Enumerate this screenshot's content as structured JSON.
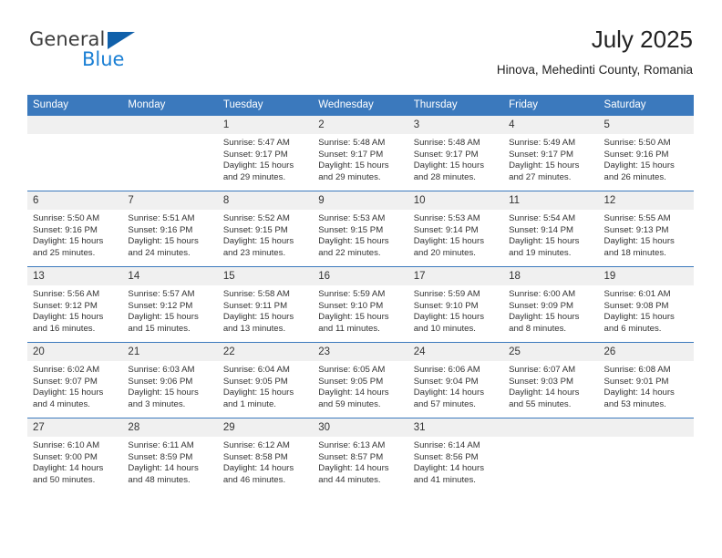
{
  "brand": {
    "name_part1": "General",
    "name_part2": "Blue",
    "triangle_color": "#1060aa",
    "blue_color": "#1a7fd4"
  },
  "header": {
    "title": "July 2025",
    "subtitle": "Hinova, Mehedinti County, Romania"
  },
  "calendar": {
    "accent_color": "#3b79bd",
    "daynum_band_color": "#f0f0f0",
    "weekday_headers": [
      "Sunday",
      "Monday",
      "Tuesday",
      "Wednesday",
      "Thursday",
      "Friday",
      "Saturday"
    ],
    "weeks": [
      [
        {
          "day": "",
          "lines": []
        },
        {
          "day": "",
          "lines": []
        },
        {
          "day": "1",
          "lines": [
            "Sunrise: 5:47 AM",
            "Sunset: 9:17 PM",
            "Daylight: 15 hours",
            "and 29 minutes."
          ]
        },
        {
          "day": "2",
          "lines": [
            "Sunrise: 5:48 AM",
            "Sunset: 9:17 PM",
            "Daylight: 15 hours",
            "and 29 minutes."
          ]
        },
        {
          "day": "3",
          "lines": [
            "Sunrise: 5:48 AM",
            "Sunset: 9:17 PM",
            "Daylight: 15 hours",
            "and 28 minutes."
          ]
        },
        {
          "day": "4",
          "lines": [
            "Sunrise: 5:49 AM",
            "Sunset: 9:17 PM",
            "Daylight: 15 hours",
            "and 27 minutes."
          ]
        },
        {
          "day": "5",
          "lines": [
            "Sunrise: 5:50 AM",
            "Sunset: 9:16 PM",
            "Daylight: 15 hours",
            "and 26 minutes."
          ]
        }
      ],
      [
        {
          "day": "6",
          "lines": [
            "Sunrise: 5:50 AM",
            "Sunset: 9:16 PM",
            "Daylight: 15 hours",
            "and 25 minutes."
          ]
        },
        {
          "day": "7",
          "lines": [
            "Sunrise: 5:51 AM",
            "Sunset: 9:16 PM",
            "Daylight: 15 hours",
            "and 24 minutes."
          ]
        },
        {
          "day": "8",
          "lines": [
            "Sunrise: 5:52 AM",
            "Sunset: 9:15 PM",
            "Daylight: 15 hours",
            "and 23 minutes."
          ]
        },
        {
          "day": "9",
          "lines": [
            "Sunrise: 5:53 AM",
            "Sunset: 9:15 PM",
            "Daylight: 15 hours",
            "and 22 minutes."
          ]
        },
        {
          "day": "10",
          "lines": [
            "Sunrise: 5:53 AM",
            "Sunset: 9:14 PM",
            "Daylight: 15 hours",
            "and 20 minutes."
          ]
        },
        {
          "day": "11",
          "lines": [
            "Sunrise: 5:54 AM",
            "Sunset: 9:14 PM",
            "Daylight: 15 hours",
            "and 19 minutes."
          ]
        },
        {
          "day": "12",
          "lines": [
            "Sunrise: 5:55 AM",
            "Sunset: 9:13 PM",
            "Daylight: 15 hours",
            "and 18 minutes."
          ]
        }
      ],
      [
        {
          "day": "13",
          "lines": [
            "Sunrise: 5:56 AM",
            "Sunset: 9:12 PM",
            "Daylight: 15 hours",
            "and 16 minutes."
          ]
        },
        {
          "day": "14",
          "lines": [
            "Sunrise: 5:57 AM",
            "Sunset: 9:12 PM",
            "Daylight: 15 hours",
            "and 15 minutes."
          ]
        },
        {
          "day": "15",
          "lines": [
            "Sunrise: 5:58 AM",
            "Sunset: 9:11 PM",
            "Daylight: 15 hours",
            "and 13 minutes."
          ]
        },
        {
          "day": "16",
          "lines": [
            "Sunrise: 5:59 AM",
            "Sunset: 9:10 PM",
            "Daylight: 15 hours",
            "and 11 minutes."
          ]
        },
        {
          "day": "17",
          "lines": [
            "Sunrise: 5:59 AM",
            "Sunset: 9:10 PM",
            "Daylight: 15 hours",
            "and 10 minutes."
          ]
        },
        {
          "day": "18",
          "lines": [
            "Sunrise: 6:00 AM",
            "Sunset: 9:09 PM",
            "Daylight: 15 hours",
            "and 8 minutes."
          ]
        },
        {
          "day": "19",
          "lines": [
            "Sunrise: 6:01 AM",
            "Sunset: 9:08 PM",
            "Daylight: 15 hours",
            "and 6 minutes."
          ]
        }
      ],
      [
        {
          "day": "20",
          "lines": [
            "Sunrise: 6:02 AM",
            "Sunset: 9:07 PM",
            "Daylight: 15 hours",
            "and 4 minutes."
          ]
        },
        {
          "day": "21",
          "lines": [
            "Sunrise: 6:03 AM",
            "Sunset: 9:06 PM",
            "Daylight: 15 hours",
            "and 3 minutes."
          ]
        },
        {
          "day": "22",
          "lines": [
            "Sunrise: 6:04 AM",
            "Sunset: 9:05 PM",
            "Daylight: 15 hours",
            "and 1 minute."
          ]
        },
        {
          "day": "23",
          "lines": [
            "Sunrise: 6:05 AM",
            "Sunset: 9:05 PM",
            "Daylight: 14 hours",
            "and 59 minutes."
          ]
        },
        {
          "day": "24",
          "lines": [
            "Sunrise: 6:06 AM",
            "Sunset: 9:04 PM",
            "Daylight: 14 hours",
            "and 57 minutes."
          ]
        },
        {
          "day": "25",
          "lines": [
            "Sunrise: 6:07 AM",
            "Sunset: 9:03 PM",
            "Daylight: 14 hours",
            "and 55 minutes."
          ]
        },
        {
          "day": "26",
          "lines": [
            "Sunrise: 6:08 AM",
            "Sunset: 9:01 PM",
            "Daylight: 14 hours",
            "and 53 minutes."
          ]
        }
      ],
      [
        {
          "day": "27",
          "lines": [
            "Sunrise: 6:10 AM",
            "Sunset: 9:00 PM",
            "Daylight: 14 hours",
            "and 50 minutes."
          ]
        },
        {
          "day": "28",
          "lines": [
            "Sunrise: 6:11 AM",
            "Sunset: 8:59 PM",
            "Daylight: 14 hours",
            "and 48 minutes."
          ]
        },
        {
          "day": "29",
          "lines": [
            "Sunrise: 6:12 AM",
            "Sunset: 8:58 PM",
            "Daylight: 14 hours",
            "and 46 minutes."
          ]
        },
        {
          "day": "30",
          "lines": [
            "Sunrise: 6:13 AM",
            "Sunset: 8:57 PM",
            "Daylight: 14 hours",
            "and 44 minutes."
          ]
        },
        {
          "day": "31",
          "lines": [
            "Sunrise: 6:14 AM",
            "Sunset: 8:56 PM",
            "Daylight: 14 hours",
            "and 41 minutes."
          ]
        },
        {
          "day": "",
          "lines": []
        },
        {
          "day": "",
          "lines": []
        }
      ]
    ]
  }
}
